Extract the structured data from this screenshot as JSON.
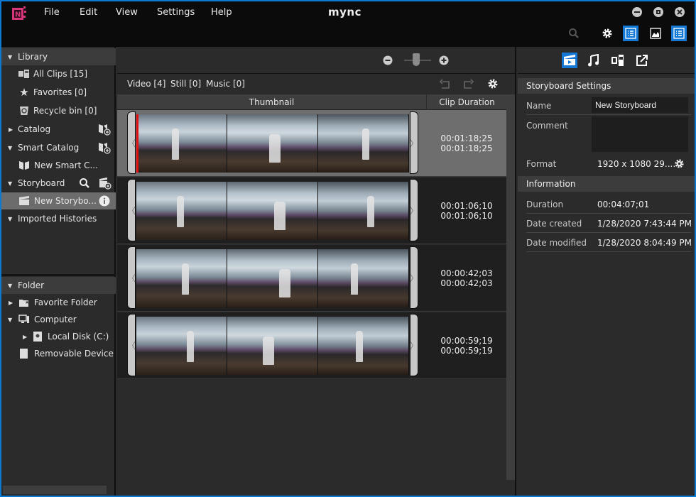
{
  "app": {
    "title": "mync",
    "logo": "mync-logo-icon",
    "menu": [
      "File",
      "Edit",
      "View",
      "Settings",
      "Help"
    ],
    "window_controls": [
      "minimize-icon",
      "maximize-icon",
      "close-icon"
    ],
    "toolbar_icons": [
      "search-icon",
      "gear-icon",
      "list-view-icon",
      "image-view-icon",
      "detail-view-icon"
    ],
    "accent_color": "#1478d4"
  },
  "left_panel": {
    "library": {
      "label": "Library",
      "items": [
        {
          "label": "All Clips [15]",
          "icon": "all-clips-icon"
        },
        {
          "label": "Favorites [0]",
          "icon": "star-icon"
        },
        {
          "label": "Recycle bin [0]",
          "icon": "recycle-bin-icon"
        }
      ]
    },
    "catalog": {
      "label": "Catalog",
      "action_icon": "add-catalog-icon"
    },
    "smart_catalog": {
      "label": "Smart Catalog",
      "action_icon": "add-smart-catalog-icon",
      "items": [
        {
          "label": "New Smart C...",
          "icon": "book-icon"
        }
      ]
    },
    "storyboard": {
      "label": "Storyboard",
      "action_icons": [
        "search-icon",
        "add-storyboard-icon"
      ],
      "items": [
        {
          "label": "New Storybo...",
          "icon": "clapper-icon",
          "selected": true,
          "action_icon": "info-icon"
        }
      ]
    },
    "imported_histories": {
      "label": "Imported Histories"
    },
    "folder": {
      "label": "Folder",
      "items": [
        {
          "label": "Favorite Folder",
          "icon": "favorite-folder-icon"
        },
        {
          "label": "Computer",
          "icon": "computer-icon"
        },
        {
          "label": "Local Disk (C:)",
          "icon": "disk-icon"
        },
        {
          "label": "Removable Device",
          "icon": "removable-device-icon"
        }
      ]
    }
  },
  "center_panel": {
    "zoom_controls": {
      "minus": "zoom-out-icon",
      "plus": "zoom-in-icon",
      "level": 0.2
    },
    "filters": [
      "Video [4]",
      "Still [0]",
      "Music [0]"
    ],
    "actions": [
      "undo-icon",
      "redo-icon",
      "gear-icon"
    ],
    "columns": [
      "Thumbnail",
      "Clip Duration"
    ],
    "clips": [
      {
        "duration_in": "00:01:18;25",
        "duration_out": "00:01:18;25",
        "selected": true
      },
      {
        "duration_in": "00:01:06;10",
        "duration_out": "00:01:06;10",
        "selected": false
      },
      {
        "duration_in": "00:00:42;03",
        "duration_out": "00:00:42;03",
        "selected": false
      },
      {
        "duration_in": "00:00:59;19",
        "duration_out": "00:00:59;19",
        "selected": false
      }
    ]
  },
  "right_panel": {
    "tabs": [
      "storyboard-tab-icon",
      "music-tab-icon",
      "transition-tab-icon",
      "export-tab-icon"
    ],
    "storyboard_settings": {
      "title": "Storyboard Settings",
      "name_label": "Name",
      "name_value": "New Storyboard",
      "comment_label": "Comment",
      "comment_value": "",
      "format_label": "Format",
      "format_value": "1920 x 1080 29...."
    },
    "information": {
      "title": "Information",
      "rows": [
        {
          "label": "Duration",
          "value": "00:04:07;01"
        },
        {
          "label": "Date created",
          "value": "1/28/2020 7:43:44 PM"
        },
        {
          "label": "Date modified",
          "value": "1/28/2020 8:04:49 PM"
        }
      ]
    }
  }
}
